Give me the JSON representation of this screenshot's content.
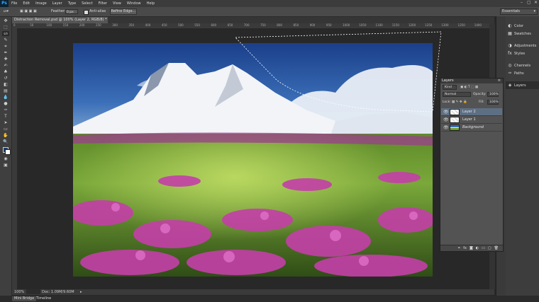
{
  "app": {
    "logo": "Ps"
  },
  "menu": [
    "File",
    "Edit",
    "Image",
    "Layer",
    "Type",
    "Select",
    "Filter",
    "View",
    "Window",
    "Help"
  ],
  "window_controls": [
    "–",
    "▢",
    "✕"
  ],
  "options": {
    "feather_label": "Feather:",
    "feather_value": "0 px",
    "anti_alias_label": "Anti-alias",
    "refine_edge_label": "Refine Edge..."
  },
  "workspace": {
    "value": "Essentials"
  },
  "document_tab": {
    "title": "Distraction Removal.psd @ 100% (Layer 2, RGB/8) *"
  },
  "ruler_ticks": [
    "0",
    "50",
    "100",
    "150",
    "200",
    "250",
    "300",
    "350",
    "400",
    "450",
    "500",
    "550",
    "600",
    "650",
    "700",
    "750",
    "800",
    "850",
    "900",
    "950",
    "1000",
    "1050",
    "1100",
    "1150",
    "1200",
    "1250",
    "1300",
    "1350",
    "1400"
  ],
  "status": {
    "zoom": "100%",
    "doc": "Doc: 1.09M/9.60M"
  },
  "bottom_tabs": [
    "Mini Bridge",
    "Timeline"
  ],
  "right_panel": [
    {
      "label": "Color",
      "icon": "color-icon"
    },
    {
      "label": "Swatches",
      "icon": "swatches-icon"
    },
    {
      "label": "Adjustments",
      "icon": "adjustments-icon"
    },
    {
      "label": "Styles",
      "icon": "styles-icon"
    },
    {
      "label": "Channels",
      "icon": "channels-icon"
    },
    {
      "label": "Paths",
      "icon": "paths-icon"
    },
    {
      "label": "Layers",
      "icon": "layers-icon"
    }
  ],
  "layers_panel": {
    "title": "Layers",
    "filter_kind": "Kind",
    "blend_mode": "Normal",
    "opacity_label": "Opacity:",
    "opacity_value": "100%",
    "lock_label": "Lock:",
    "fill_label": "Fill:",
    "fill_value": "100%",
    "layers": [
      {
        "name": "Layer 2",
        "selected": true,
        "visible": true
      },
      {
        "name": "Layer 1",
        "selected": false,
        "visible": true
      },
      {
        "name": "Background",
        "selected": false,
        "visible": true
      }
    ],
    "footer_icons": [
      "link-icon",
      "fx-icon",
      "mask-icon",
      "adjustment-layer-icon",
      "group-icon",
      "new-layer-icon",
      "trash-icon"
    ]
  },
  "colors": {
    "accent": "#31a8ff",
    "selection_row": "#5d6f83"
  }
}
